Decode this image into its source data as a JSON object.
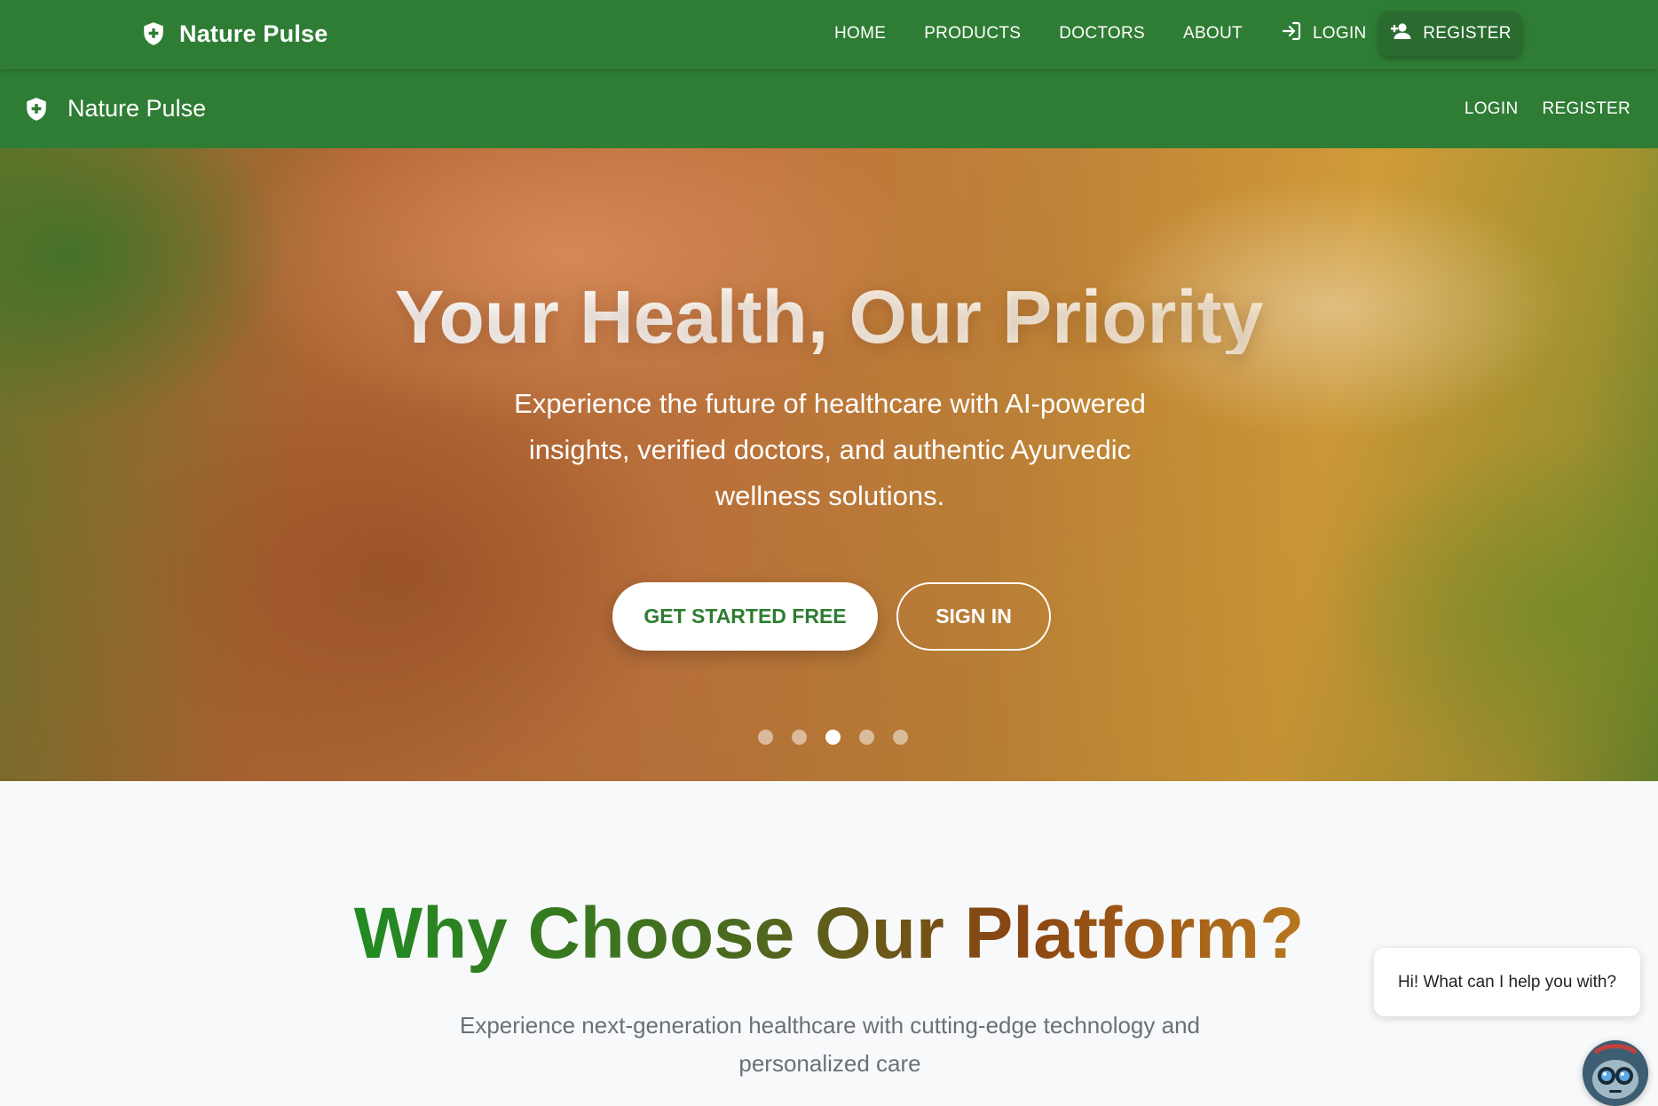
{
  "top_nav": {
    "brand": "Nature Pulse",
    "links": [
      {
        "label": "HOME"
      },
      {
        "label": "PRODUCTS"
      },
      {
        "label": "DOCTORS"
      },
      {
        "label": "ABOUT"
      },
      {
        "label": "LOGIN",
        "icon": "login-icon"
      }
    ],
    "register_label": "REGISTER",
    "register_icon": "person-add-icon",
    "brand_icon": "shield-plus-icon"
  },
  "sub_nav": {
    "brand": "Nature Pulse",
    "brand_icon": "shield-plus-icon",
    "login_label": "LOGIN",
    "register_label": "REGISTER"
  },
  "hero": {
    "title": "Your Health, Our Priority",
    "subtitle": "Experience the future of healthcare with AI-powered insights, verified doctors, and authentic Ayurvedic wellness solutions.",
    "primary_cta": "GET STARTED FREE",
    "secondary_cta": "SIGN IN",
    "carousel": {
      "count": 5,
      "active_index": 2
    }
  },
  "why": {
    "title": "Why Choose Our Platform?",
    "subtitle": "Experience next-generation healthcare with cutting-edge technology and personalized care"
  },
  "chat": {
    "message": "Hi! What can I help you with?",
    "avatar_icon": "robot-avatar-icon"
  },
  "colors": {
    "nav_green": "#2f7d35",
    "brand_green": "#2e7d32",
    "page_bg": "#f8f9fa",
    "muted_text": "#6b6f78"
  }
}
